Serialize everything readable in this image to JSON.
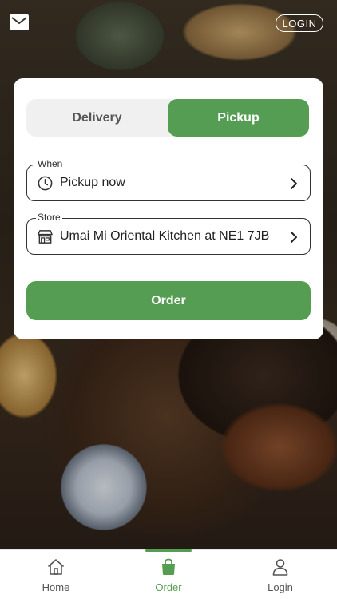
{
  "header": {
    "login_label": "LOGIN",
    "mail_icon": "mail-icon"
  },
  "mode_toggle": {
    "delivery_label": "Delivery",
    "pickup_label": "Pickup",
    "selected": "Pickup"
  },
  "when_field": {
    "label": "When",
    "value": "Pickup now",
    "icon": "clock-icon"
  },
  "store_field": {
    "label": "Store",
    "value": "Umai Mi Oriental Kitchen at NE1 7JB",
    "icon": "store-icon"
  },
  "order_button": {
    "label": "Order"
  },
  "bottom_nav": {
    "items": [
      {
        "label": "Home",
        "icon": "home-icon"
      },
      {
        "label": "Order",
        "icon": "shopping-bag-icon",
        "active": true
      },
      {
        "label": "Login",
        "icon": "user-icon"
      }
    ]
  },
  "colors": {
    "accent": "#559d52",
    "segment_bg": "#f0f0f0",
    "card_bg": "#ffffff"
  }
}
